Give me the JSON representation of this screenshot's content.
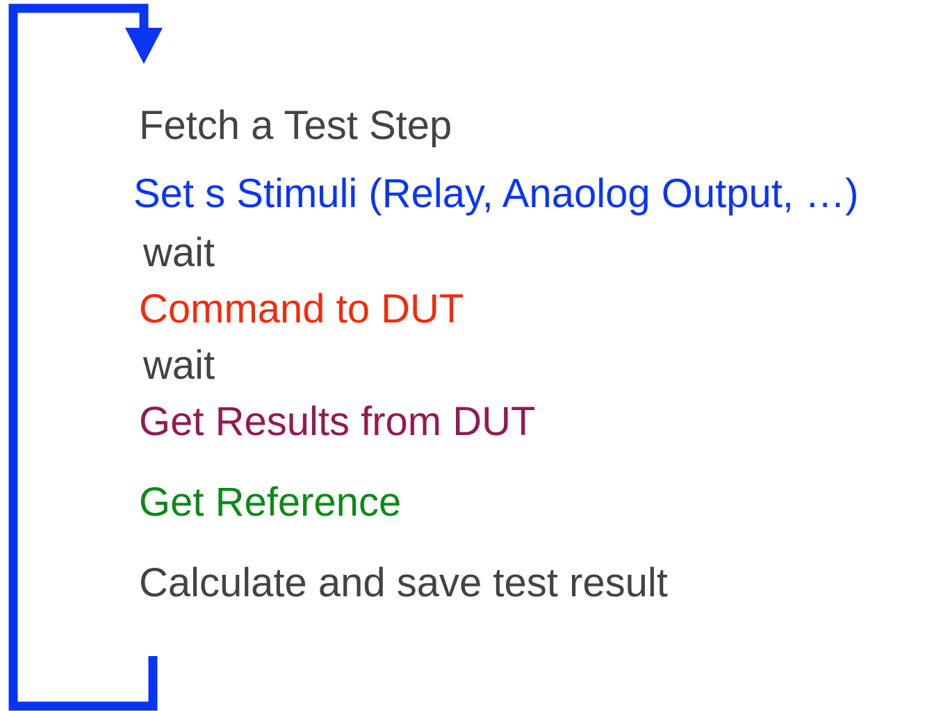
{
  "colors": {
    "loop_arrow": "#0a35f5",
    "default_text": "#434343"
  },
  "loop": {
    "connector_icon": "loop-back-arrow-icon",
    "arrowhead_icon": "arrow-down-icon"
  },
  "steps": [
    {
      "label": "Fetch a Test Step",
      "color": "#434343"
    },
    {
      "label": "Set s Stimuli (Relay, Anaolog Output, …)",
      "color": "#0a35f5"
    },
    {
      "label": "wait",
      "color": "#434343"
    },
    {
      "label": "Command to DUT",
      "color": "#f42a0c"
    },
    {
      "label": "wait",
      "color": "#434343"
    },
    {
      "label": "Get Results from DUT",
      "color": "#931a52"
    },
    {
      "label": "Get Reference",
      "color": "#0b8a17"
    },
    {
      "label": "Calculate and save test result",
      "color": "#434343"
    }
  ]
}
